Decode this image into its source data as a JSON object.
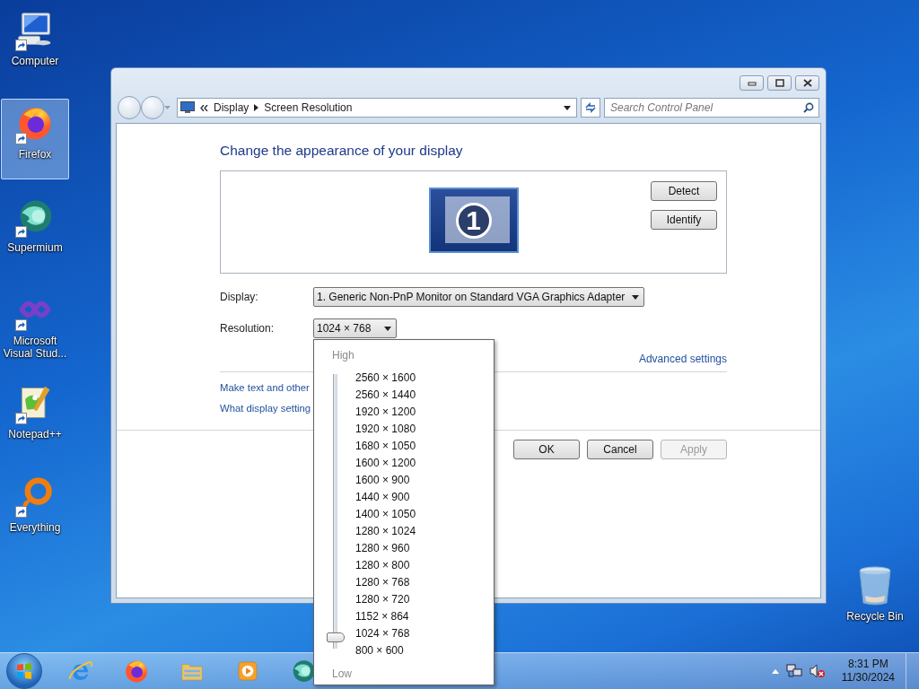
{
  "desktop_icons": [
    {
      "label": "Computer",
      "kind": "computer",
      "selected": false
    },
    {
      "label": "Firefox",
      "kind": "firefox",
      "selected": true
    },
    {
      "label": "Supermium",
      "kind": "supermium",
      "selected": false
    },
    {
      "label": "Microsoft Visual Stud...",
      "kind": "vstudio",
      "selected": false
    },
    {
      "label": "Notepad++",
      "kind": "notepad",
      "selected": false
    },
    {
      "label": "Everything",
      "kind": "everything",
      "selected": false
    }
  ],
  "recycle_bin": {
    "label": "Recycle Bin"
  },
  "window": {
    "breadcrumb": [
      "Display",
      "Screen Resolution"
    ],
    "search": {
      "placeholder": "Search Control Panel"
    },
    "heading": "Change the appearance of your display",
    "monitor_number": "1",
    "detect_button": "Detect",
    "identify_button": "Identify",
    "display": {
      "label": "Display:",
      "value": "1. Generic Non-PnP Monitor on Standard VGA Graphics Adapter"
    },
    "resolution": {
      "label": "Resolution:",
      "value": "1024 × 768"
    },
    "advanced_link": "Advanced settings",
    "links": [
      "Make text and other",
      "What display setting"
    ],
    "buttons": [
      {
        "label": "OK",
        "disabled": false
      },
      {
        "label": "Cancel",
        "disabled": false
      },
      {
        "label": "Apply",
        "disabled": true
      }
    ]
  },
  "resolution_dropdown": {
    "high_label": "High",
    "low_label": "Low",
    "level": 0.0625,
    "options": [
      "2560 × 1600",
      "2560 × 1440",
      "1920 × 1200",
      "1920 × 1080",
      "1680 × 1050",
      "1600 × 1200",
      "1600 × 900",
      "1440 × 900",
      "1400 × 1050",
      "1280 × 1024",
      "1280 × 960",
      "1280 × 800",
      "1280 × 768",
      "1280 × 720",
      "1152 × 864",
      "1024 × 768",
      "800 × 600"
    ]
  },
  "taskbar": {
    "apps": [
      {
        "kind": "ie"
      },
      {
        "kind": "firefox"
      },
      {
        "kind": "explorer"
      },
      {
        "kind": "media"
      },
      {
        "kind": "supermium"
      }
    ],
    "clock": {
      "time": "8:31 PM",
      "date": "11/30/2024"
    }
  }
}
